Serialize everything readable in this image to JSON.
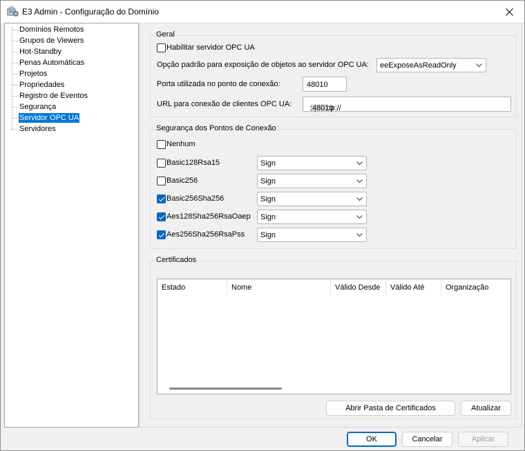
{
  "window": {
    "title": "E3 Admin - Configuração do Domínio"
  },
  "tree": {
    "items": [
      {
        "label": "Domínios Remotos",
        "selected": false
      },
      {
        "label": "Grupos de Viewers",
        "selected": false
      },
      {
        "label": "Hot-Standby",
        "selected": false
      },
      {
        "label": "Penas Automáticas",
        "selected": false
      },
      {
        "label": "Projetos",
        "selected": false
      },
      {
        "label": "Propriedades",
        "selected": false
      },
      {
        "label": "Registro de Eventos",
        "selected": false
      },
      {
        "label": "Segurança",
        "selected": false
      },
      {
        "label": "Servidor OPC UA",
        "selected": true
      },
      {
        "label": "Servidores",
        "selected": false
      }
    ]
  },
  "general": {
    "title": "Geral",
    "enable_label": "Habilitar servidor OPC UA",
    "enable_checked": false,
    "expose_label": "Opção padrão para exposição de objetos ao servidor OPC UA:",
    "expose_value": "eeExposeAsReadOnly",
    "port_label": "Porta utilizada no ponto de conexão:",
    "port_value": "48010",
    "url_label": "URL para conexão de clientes OPC UA:",
    "url_prefix": "opc.tcp://",
    "url_suffix": ":48010"
  },
  "security": {
    "title": "Segurança dos Pontos de Conexão",
    "none_label": "Nenhum",
    "none_checked": false,
    "policies": [
      {
        "label": "Basic128Rsa15",
        "checked": false,
        "mode": "Sign"
      },
      {
        "label": "Basic256",
        "checked": false,
        "mode": "Sign"
      },
      {
        "label": "Basic256Sha256",
        "checked": true,
        "mode": "Sign"
      },
      {
        "label": "Aes128Sha256RsaOaep",
        "checked": true,
        "mode": "Sign"
      },
      {
        "label": "Aes256Sha256RsaPss",
        "checked": true,
        "mode": "Sign"
      }
    ]
  },
  "certificates": {
    "title": "Certificados",
    "columns": [
      "Estado",
      "Nome",
      "Válido Desde",
      "Válido Até",
      "Organização"
    ],
    "rows": [],
    "open_folder_label": "Abrir Pasta de Certificados",
    "refresh_label": "Atualizar"
  },
  "footer": {
    "ok_label": "OK",
    "cancel_label": "Cancelar",
    "apply_label": "Aplicar"
  },
  "colors": {
    "accent": "#0067c0",
    "selection": "#0078d7"
  }
}
